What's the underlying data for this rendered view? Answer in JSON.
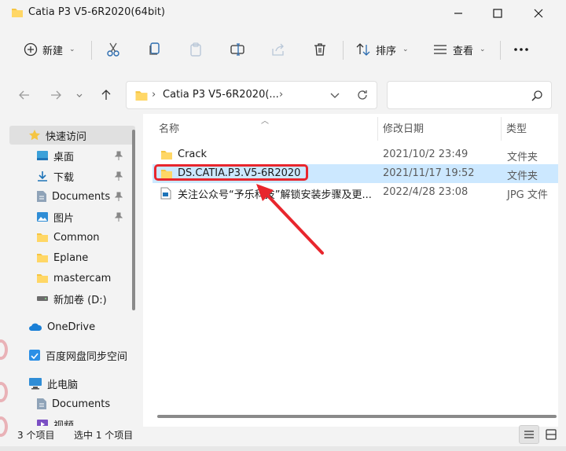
{
  "window": {
    "title": "Catia P3 V5-6R2020(64bit)"
  },
  "toolbar": {
    "new_label": "新建",
    "sort_label": "排序",
    "view_label": "查看"
  },
  "address": {
    "path": "Catia P3 V5-6R2020(..."
  },
  "sidebar": {
    "items": [
      {
        "label": "快速访问",
        "icon": "star-icon"
      },
      {
        "label": "桌面",
        "icon": "desktop-icon",
        "pinned": true
      },
      {
        "label": "下载",
        "icon": "download-icon",
        "pinned": true
      },
      {
        "label": "Documents",
        "icon": "documents-icon",
        "pinned": true
      },
      {
        "label": "图片",
        "icon": "pictures-icon",
        "pinned": true
      },
      {
        "label": "Common",
        "icon": "folder-icon"
      },
      {
        "label": "Eplane",
        "icon": "folder-icon"
      },
      {
        "label": "mastercam",
        "icon": "folder-icon"
      },
      {
        "label": "新加卷 (D:)",
        "icon": "drive-icon"
      },
      {
        "label": "OneDrive",
        "icon": "cloud-icon"
      },
      {
        "label": "百度网盘同步空间",
        "icon": "baidu-sync-icon"
      },
      {
        "label": "此电脑",
        "icon": "computer-icon"
      },
      {
        "label": "Documents",
        "icon": "documents-icon"
      },
      {
        "label": "视频",
        "icon": "video-icon"
      }
    ]
  },
  "columns": {
    "name": "名称",
    "date": "修改日期",
    "type": "类型"
  },
  "files": [
    {
      "name": "Crack",
      "date": "2021/10/2 23:49",
      "type": "文件夹"
    },
    {
      "name": "DS.CATIA.P3.V5-6R2020",
      "date": "2021/11/17 19:52",
      "type": "文件夹"
    },
    {
      "name": "关注公众号“予乐科技”解锁安装步骤及更...",
      "date": "2022/4/28 23:08",
      "type": "JPG 文件"
    }
  ],
  "status": {
    "count": "3 个项目",
    "selection": "选中 1 个项目"
  },
  "colors": {
    "accent_selection": "#cce8ff",
    "highlight": "#e8262d",
    "folder": "#f5c542"
  }
}
